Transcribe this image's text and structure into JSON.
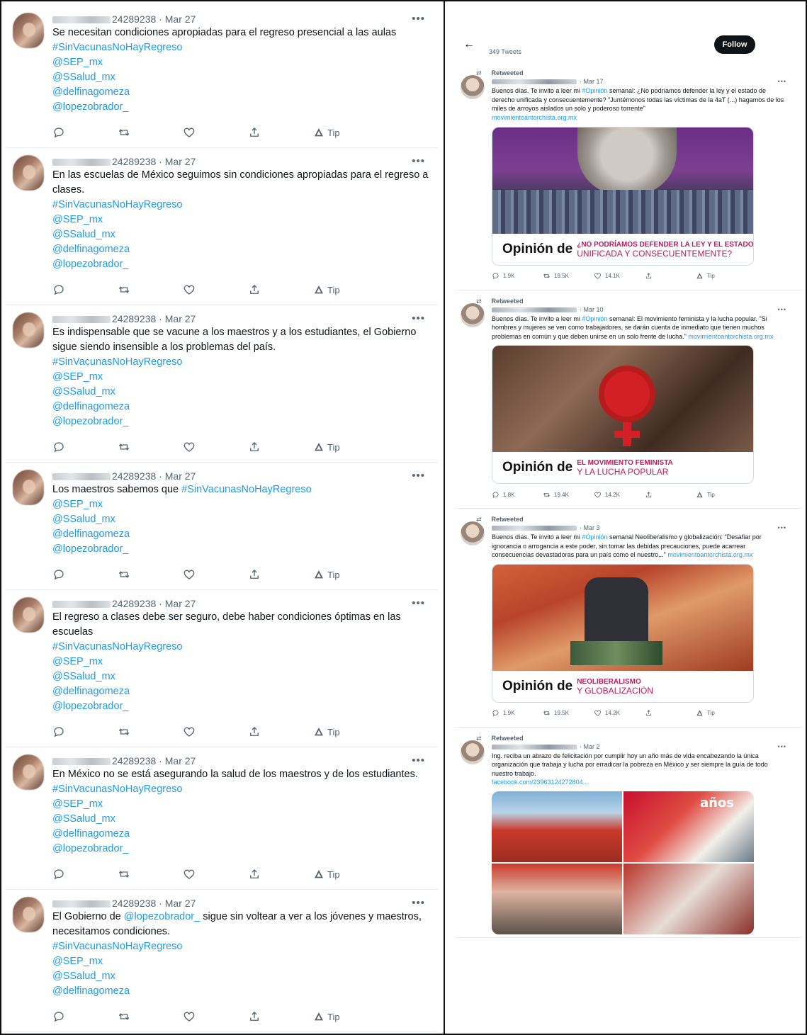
{
  "left_tweets": [
    {
      "id_suffix": "24289238",
      "date": "Mar 27",
      "text": "Se necesitan condiciones apropiadas para el regreso presencial a las aulas",
      "tags": [
        "#SinVacunasNoHayRegreso",
        "@SEP_mx",
        "@SSalud_mx",
        "@delfinagomeza",
        "@lopezobrador_"
      ]
    },
    {
      "id_suffix": "24289238",
      "date": "Mar 27",
      "text": "En las escuelas de México seguimos sin condiciones apropiadas para el regreso a clases.",
      "tags": [
        "#SinVacunasNoHayRegreso",
        "@SEP_mx",
        "@SSalud_mx",
        "@delfinagomeza",
        "@lopezobrador_"
      ]
    },
    {
      "id_suffix": "24289238",
      "date": "Mar 27",
      "text": "Es indispensable que se vacune a los maestros y a los estudiantes, el Gobierno sigue siendo insensible a los problemas del país.",
      "tags": [
        "#SinVacunasNoHayRegreso",
        "@SEP_mx",
        "@SSalud_mx",
        "@delfinagomeza",
        "@lopezobrador_"
      ]
    },
    {
      "id_suffix": "24289238",
      "date": "Mar 27",
      "text": "Los maestros sabemos que ",
      "inline_tag": "#SinVacunasNoHayRegreso",
      "tags": [
        "@SEP_mx",
        "@SSalud_mx",
        "@delfinagomeza",
        "@lopezobrador_"
      ]
    },
    {
      "id_suffix": "24289238",
      "date": "Mar 27",
      "text": "El regreso a clases debe ser seguro, debe haber condiciones óptimas en las escuelas",
      "tags": [
        "#SinVacunasNoHayRegreso",
        "@SEP_mx",
        "@SSalud_mx",
        "@delfinagomeza",
        "@lopezobrador_"
      ]
    },
    {
      "id_suffix": "24289238",
      "date": "Mar 27",
      "text": "En México no se está asegurando la salud de los maestros y de los estudiantes.  ",
      "inline_tag": "#SinVacunasNoHayRegreso",
      "tags": [
        "@SEP_mx",
        "@SSalud_mx",
        "@delfinagomeza",
        "@lopezobrador_"
      ]
    },
    {
      "id_suffix": "24289238",
      "date": "Mar 27",
      "text_before": "El Gobierno de ",
      "mention": "@lopezobrador_",
      "text_after": " sigue sin voltear a ver a los jóvenes y maestros, necesitamos condiciones.",
      "tags": [
        "#SinVacunasNoHayRegreso",
        "@SEP_mx",
        "@SSalud_mx",
        "@delfinagomeza"
      ]
    }
  ],
  "left_actions": {
    "tip": "Tip"
  },
  "right": {
    "tweet_count": "349 Tweets",
    "follow_label": "Follow",
    "retweeted_label": "Retweeted",
    "tweets": [
      {
        "date": "Mar 17",
        "text_a": "Buenos días. Te invito a leer mi ",
        "hashtag": "#Opinión",
        "text_b": " semanal: ¿No podríamos defender la ley y el estado de derecho unificada y consecuentemente? \"Juntémonos todas las víctimas de la 4aT (...) hagamos de los miles de arroyos aislados un solo y poderoso torrente\"",
        "link": "movimientoantorchista.org.mx",
        "card_title": "Opinión de",
        "card_sub1": "¿NO PODRÍAMOS DEFENDER LA LEY Y EL ESTADO DE DERECHO",
        "card_sub2": "UNIFICADA Y CONSECUENTEMENTE?",
        "replies": "1.9K",
        "retweets": "19.5K",
        "likes": "14.1K",
        "tip": "Tip"
      },
      {
        "date": "Mar 10",
        "text_a": "Buenos días. Te invito a leer mi ",
        "hashtag": "#Opinión",
        "text_b": " semanal: El movimiento feminista y la lucha popular. \"Si hombres y mujeres se ven como trabajadores, se darán cuenta de inmediato que tienen muchos problemas en común y que deben unirse en un solo frente de lucha.\" ",
        "link": "movimientoantorchista.org.mx",
        "card_title": "Opinión de",
        "card_sub1": "EL MOVIMIENTO FEMINISTA",
        "card_sub2": "Y LA LUCHA POPULAR",
        "replies": "1.8K",
        "retweets": "19.4K",
        "likes": "14.2K",
        "tip": "Tip"
      },
      {
        "date": "Mar 3",
        "text_a": "Buenos días. Te invito a leer mi ",
        "hashtag": "#Opinión",
        "text_b": " semanal Neoliberalismo y globalización: \"Desafiar por ignorancia o arrogancia a este poder, sin tomar las debidas precauciones, puede acarrear consecuencias devastadoras para un país como el nuestro...\" ",
        "link": "movimientoantorchista.org.mx",
        "card_title": "Opinión de",
        "card_sub1": "NEOLIBERALISMO",
        "card_sub2": "Y GLOBALIZACIÓN",
        "replies": "1.9K",
        "retweets": "19.5K",
        "likes": "14.2K",
        "tip": "Tip"
      },
      {
        "date": "Mar 2",
        "text_a": "Ing. ",
        "text_b": " reciba un abrazo de felicitación por cumplir hoy un año más de vida encabezando la única organización que trabaja y lucha por erradicar la pobreza en México y ser siempre la guía de todo nuestro trabajo.",
        "link": "facebook.com/23963124272804...",
        "photo_badge": "años"
      }
    ]
  },
  "colors": {
    "link": "#1d9bf0",
    "accent_card": "#c2185b",
    "follow_bg": "#0f1419"
  }
}
